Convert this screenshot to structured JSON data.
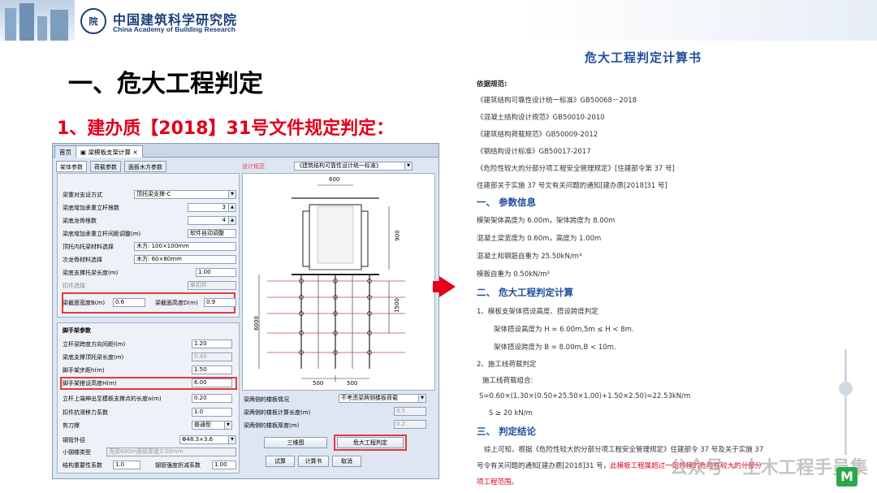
{
  "header": {
    "logo_mark": "中国建筑科学研究院",
    "org_cn": "中国建筑科学研究院",
    "org_en": "China Academy of Building Research"
  },
  "slide": {
    "title": "一、危大工程判定",
    "subtitle": "1、建办质【2018】31号文件规定判定："
  },
  "app": {
    "tabs": [
      "首页",
      "梁模板支架计算"
    ],
    "subtabs": [
      "架体参数",
      "荷载参数",
      "面板木方参数"
    ],
    "design_spec_label": "设计规范",
    "design_spec_value": "《建筑结构可靠性设计统一标准》",
    "params": [
      {
        "label": "梁重对支设方式",
        "value": "顶托梁支撑-C"
      },
      {
        "label": "梁底增加承重立杆根数",
        "value": "3"
      },
      {
        "label": "梁底龙骨根数",
        "value": "4"
      },
      {
        "label": "梁底增加承重立杆间距调整(m)",
        "value": "软件自动调整"
      },
      {
        "label": "顶托内托梁材料选择",
        "value": "木方: 100×100mm"
      },
      {
        "label": "次龙骨材料选择",
        "value": "木方: 60×80mm"
      },
      {
        "label": "梁底支撑托梁长度(m)",
        "value": "1.00"
      },
      {
        "label": "扣件选择",
        "value": "单扣件"
      }
    ],
    "beam_width_label": "梁截面宽度B(m)",
    "beam_width": "0.6",
    "beam_height_label": "梁截面高度D(m)",
    "beam_height": "0.9",
    "scaffold_section": "脚手架参数",
    "scaffold": [
      {
        "label": "立杆梁跨度方向间距l(m)",
        "value": "1.20"
      },
      {
        "label": "梁底支撑顶托梁长度(m)",
        "value": "0.40"
      },
      {
        "label": "脚手架步距h(m)",
        "value": "1.50"
      },
      {
        "label": "脚手架搭设高度H(m)",
        "value": "6.00"
      },
      {
        "label": "立杆上端伸出至模板支撑点的长度a(m)",
        "value": "0.20"
      },
      {
        "label": "扣件抗滑移力系数",
        "value": "1.0"
      },
      {
        "label": "剪刀撑",
        "value": "普通型"
      },
      {
        "label": "钢管外径",
        "value": "Φ48.3×3.6"
      },
      {
        "label": "小钢楼类型",
        "value": "壳质600m面板厚度3.00mm"
      }
    ],
    "bottom_row": {
      "label1": "结构重要性系数",
      "value1": "1.0",
      "label2": "钢管强度折减系数",
      "value2": "1.00"
    },
    "right_fields": [
      {
        "label": "梁两侧的楼板情况",
        "value": "不考虑梁两侧楼板荷载"
      },
      {
        "label": "梁两侧的楼板计算长度(m)",
        "value": "0.5"
      },
      {
        "label": "梁两侧的楼板厚度(m)",
        "value": "0.2"
      }
    ],
    "diagram": {
      "dim_top": "600",
      "dim_900": "900",
      "dim_1500": "1500",
      "dim_6000": "6000",
      "dim_500a": "500",
      "dim_500b": "500"
    },
    "buttons": {
      "diagram": "三维图",
      "judge": "危大工程判定",
      "calc": "试算",
      "book": "计算书",
      "cancel": "取消"
    }
  },
  "doc": {
    "title": "危大工程判定计算书",
    "basis": "依据规范:",
    "lines": [
      "《建筑结构可靠性设计统一标准》GB50068－2018",
      "《混凝土结构设计规范》GB50010-2010",
      "《建筑结构荷载规范》GB50009-2012",
      "《钢结构设计标准》GB50017-2017",
      "《危险性较大的分部分项工程安全管理规定》[住建部令第 37 号]",
      "住建部关于实施 37 号文有关问题的通知[建办质[2018]31 号]"
    ],
    "h1": "一、 参数信息",
    "params": [
      "模架架体高度为 6.00m，架体跨度为 8.00m",
      "混凝土梁宽度为 0.60m，高度为 1.00m",
      "混凝土和钢筋自重为 25.50kN/m³",
      "模板自重为 0.50kN/m²"
    ],
    "h2": "二、 危大工程判定计算",
    "calc": [
      "1、模板支架体搭设高度、搭设跨度判定",
      "架体搭设高度为 H = 6.00m,5m ≤ H < 8m.",
      "架体搭设跨度为 B = 8.00m,B < 10m.",
      "2、施工线荷载判定",
      "施工线荷载组合:",
      "S=0.60×(1.30×(0.50+25.50×1.00)+1.50×2.50)=22.53kN/m",
      "S ≥ 20 kN/m"
    ],
    "h3": "三、 判定结论",
    "conclusion_1": "综上可知，根据《危险性较大的分部分项工程安全管理规定》住建部令 37 号及关于实施 37",
    "conclusion_2a": "号令有关问题的通知[建办质[2018]31 号，",
    "conclusion_2b": "此模板工程属超过一定规模的危险性较大的分部分",
    "conclusion_3": "项工程范围。"
  },
  "watermark": "公众号 · 土木工程手员集",
  "watermark_logo": "M"
}
